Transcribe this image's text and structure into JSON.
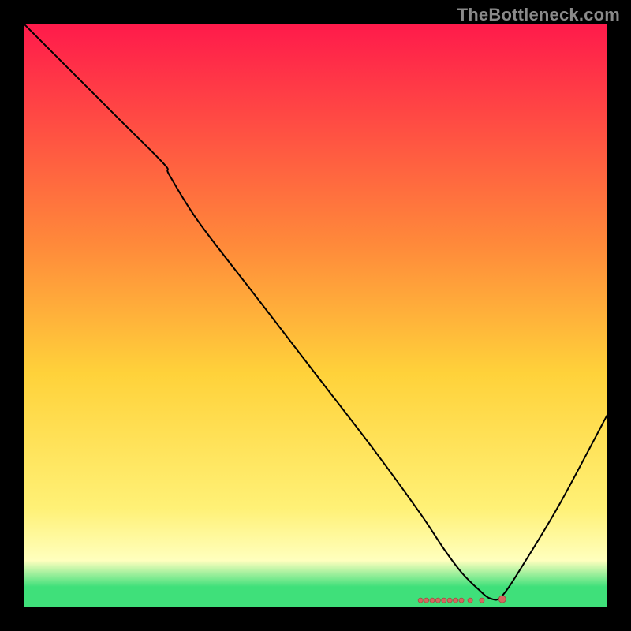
{
  "watermark": "TheBottleneck.com",
  "colors": {
    "background": "#000000",
    "axis": "#000000",
    "curve": "#000000",
    "marker_fill": "#d46a5f",
    "marker_stroke": "#9e4c43",
    "gradient_top": "#ff1a4b",
    "gradient_mid_upper": "#ff8a3a",
    "gradient_mid": "#ffd23a",
    "gradient_mid_lower": "#fff176",
    "gradient_low": "#ffffbe",
    "gradient_green": "#3fe07a"
  },
  "chart_data": {
    "type": "line",
    "title": "",
    "xlabel": "",
    "ylabel": "",
    "xlim": [
      0,
      100
    ],
    "ylim": [
      0,
      100
    ],
    "series": [
      {
        "name": "bottleneck-curve",
        "x": [
          0,
          8,
          16,
          24,
          25,
          30,
          40,
          50,
          60,
          68,
          72,
          75,
          78,
          80,
          82,
          86,
          92,
          100
        ],
        "y": [
          100,
          92,
          84,
          76,
          74,
          66,
          53,
          40,
          27,
          16,
          10,
          6,
          3,
          1.5,
          2,
          8,
          18,
          33
        ]
      }
    ],
    "markers": {
      "name": "optimal-region",
      "points": [
        {
          "x": 68.0,
          "y": 1.2
        },
        {
          "x": 69.0,
          "y": 1.2
        },
        {
          "x": 70.0,
          "y": 1.2
        },
        {
          "x": 71.0,
          "y": 1.2
        },
        {
          "x": 72.0,
          "y": 1.2
        },
        {
          "x": 73.0,
          "y": 1.2
        },
        {
          "x": 74.0,
          "y": 1.2
        },
        {
          "x": 75.0,
          "y": 1.2
        },
        {
          "x": 76.5,
          "y": 1.2
        },
        {
          "x": 78.5,
          "y": 1.2
        },
        {
          "x": 82.0,
          "y": 1.4
        }
      ],
      "radius_small": 3.0,
      "radius_large": 4.5
    },
    "gradient_stops": [
      {
        "offset": 0.0,
        "key": "gradient_top"
      },
      {
        "offset": 0.38,
        "key": "gradient_mid_upper"
      },
      {
        "offset": 0.6,
        "key": "gradient_mid"
      },
      {
        "offset": 0.83,
        "key": "gradient_mid_lower"
      },
      {
        "offset": 0.92,
        "key": "gradient_low"
      },
      {
        "offset": 0.965,
        "key": "gradient_green"
      },
      {
        "offset": 1.0,
        "key": "gradient_green"
      }
    ]
  }
}
